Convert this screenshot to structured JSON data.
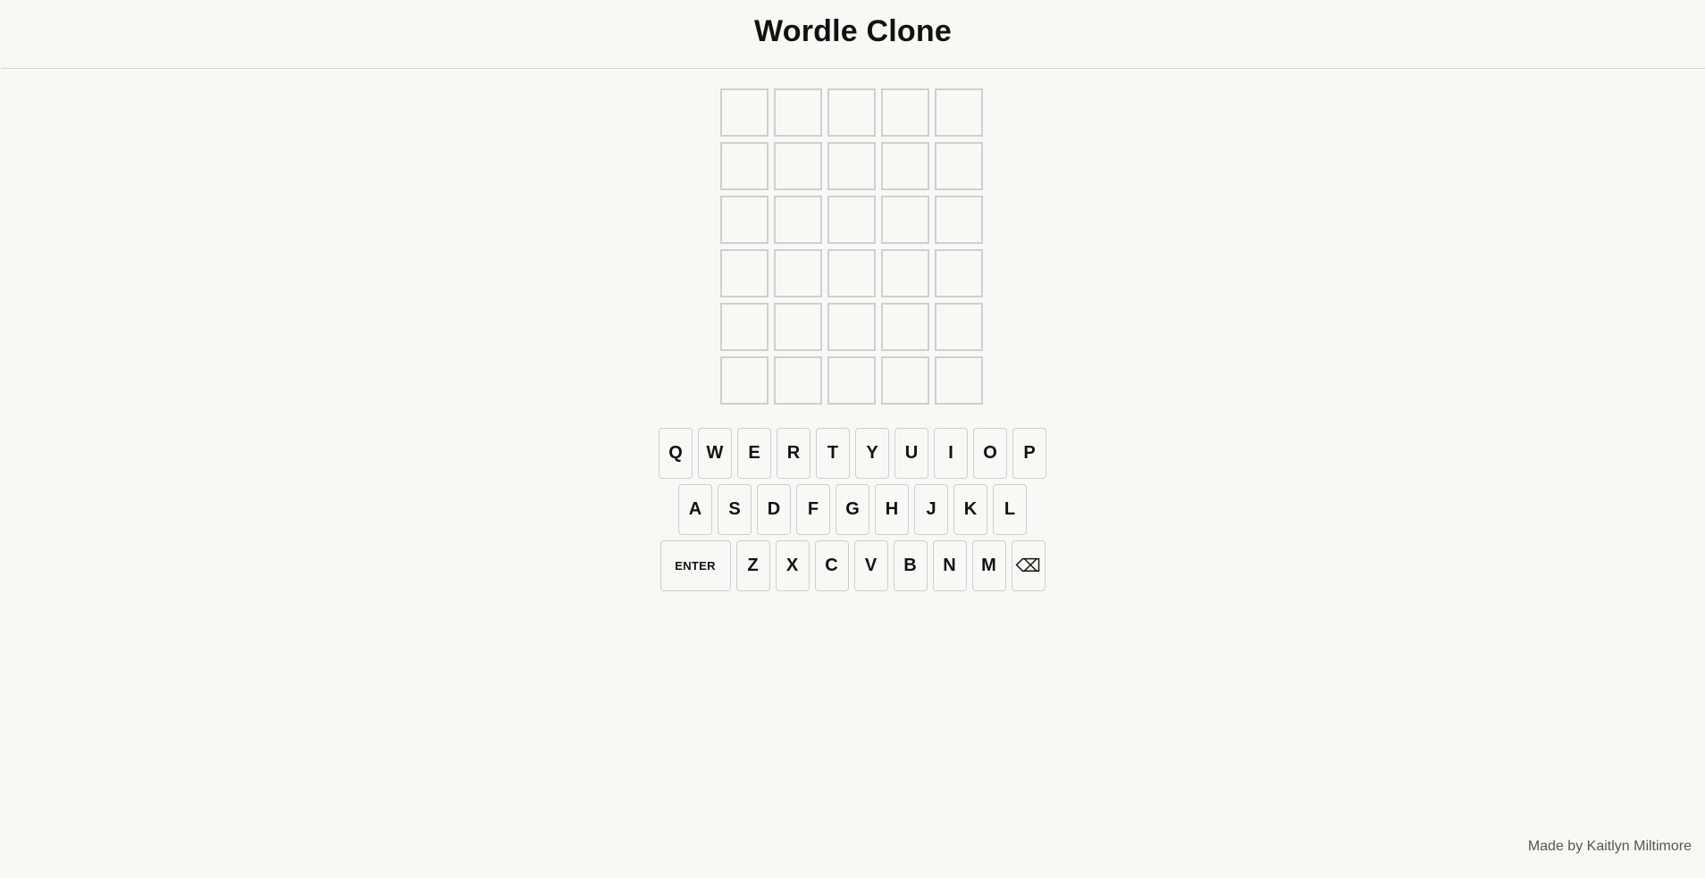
{
  "header": {
    "title": "Wordle Clone"
  },
  "board": {
    "rows": 6,
    "cols": 5,
    "tiles": [
      [
        "",
        "",
        "",
        "",
        ""
      ],
      [
        "",
        "",
        "",
        "",
        ""
      ],
      [
        "",
        "",
        "",
        "",
        ""
      ],
      [
        "",
        "",
        "",
        "",
        ""
      ],
      [
        "",
        "",
        "",
        "",
        ""
      ],
      [
        "",
        "",
        "",
        "",
        ""
      ]
    ]
  },
  "keyboard": {
    "row1": [
      "Q",
      "W",
      "E",
      "R",
      "T",
      "Y",
      "U",
      "I",
      "O",
      "P"
    ],
    "row2": [
      "A",
      "S",
      "D",
      "F",
      "G",
      "H",
      "J",
      "K",
      "L"
    ],
    "row3": [
      "ENTER",
      "Z",
      "X",
      "C",
      "V",
      "B",
      "N",
      "M",
      "⌫"
    ]
  },
  "footer": {
    "credit": "Made by Kaitlyn Miltimore"
  },
  "colors": {
    "background": "#f8f8f4",
    "tile_border": "#cfcfcf",
    "key_border": "#cfcfcf",
    "text": "#111111"
  }
}
